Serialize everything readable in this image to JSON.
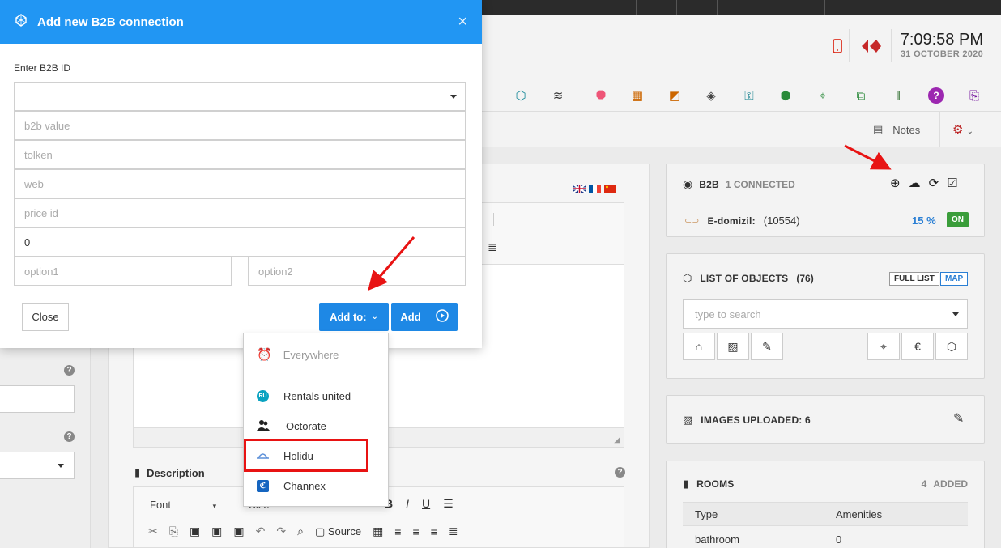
{
  "header": {
    "time": "7:09:58 PM",
    "date": "31 OCTOBER 2020"
  },
  "notesbar": {
    "notes_label": "Notes"
  },
  "flags": [
    "en",
    "fr",
    "cn"
  ],
  "description": {
    "title": "Description",
    "font_label": "Font",
    "size_label": "Size",
    "source_label": "Source"
  },
  "b2b_panel": {
    "title": "B2B",
    "connected": "1 CONNECTED",
    "row_name": "E-domizil:",
    "row_id": "(10554)",
    "row_percent": "15 %",
    "row_status": "ON"
  },
  "objects_panel": {
    "title": "LIST OF OBJECTS",
    "count": "(76)",
    "full_list": "FULL LIST",
    "map": "MAP",
    "search_placeholder": "type to search"
  },
  "images_panel": {
    "title": "IMAGES UPLOADED: 6"
  },
  "rooms_panel": {
    "title": "ROOMS",
    "added_count": "4",
    "added_label": "ADDED",
    "col_type": "Type",
    "col_amenities": "Amenities",
    "row1_type": "bathroom",
    "row1_amenities": "0"
  },
  "modal": {
    "title": "Add new B2B connection",
    "close_glyph": "×",
    "label_b2b_id": "Enter B2B ID",
    "field_b2b_value_placeholder": "b2b value",
    "field_tolken_placeholder": "tolken",
    "field_web_placeholder": "web",
    "field_price_id_placeholder": "price id",
    "field_zero_value": "0",
    "field_option1_placeholder": "option1",
    "field_option2_placeholder": "option2",
    "close_button": "Close",
    "add_to_button": "Add to:",
    "add_button": "Add"
  },
  "dropdown": {
    "everywhere": "Everywhere",
    "rentals_united": "Rentals united",
    "rentals_united_badge": "RU",
    "octorate": "Octorate",
    "holidu": "Holidu",
    "channex": "Channex"
  },
  "colors": {
    "modal_header": "#2196f3",
    "button_blue": "#1e88e5",
    "highlight_red": "#e81313",
    "on_green": "#3a9d3a",
    "percent_blue": "#2a7fd4"
  }
}
